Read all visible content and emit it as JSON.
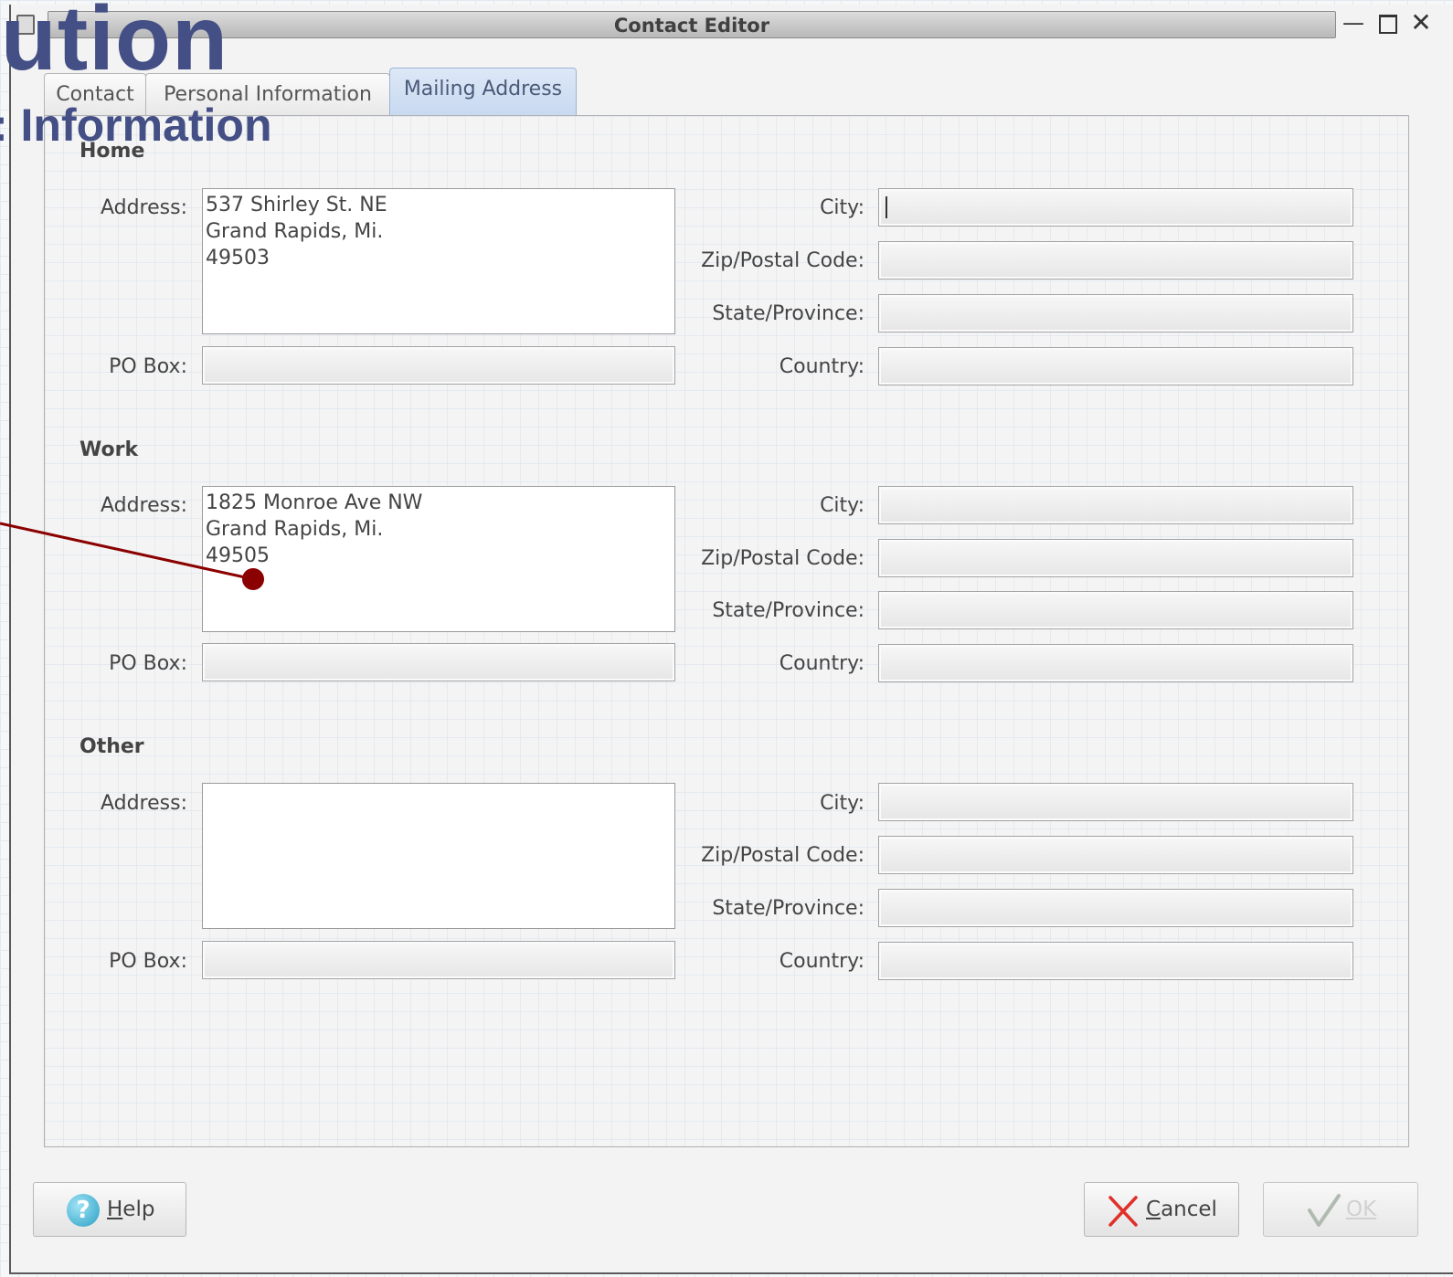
{
  "window": {
    "title": "Contact Editor"
  },
  "overlay": {
    "title": "lution",
    "subtitle": ": Information"
  },
  "tabs": [
    {
      "label": "Contact"
    },
    {
      "label": "Personal Information"
    },
    {
      "label": "Mailing Address"
    }
  ],
  "active_tab": "Mailing Address",
  "labels": {
    "address": "Address:",
    "po_box": "PO Box:",
    "city": "City:",
    "zip": "Zip/Postal Code:",
    "state": "State/Province:",
    "country": "Country:"
  },
  "sections": {
    "home": {
      "title": "Home",
      "address": "537 Shirley St. NE\nGrand Rapids, Mi.\n49503",
      "po_box": "",
      "city": "",
      "zip": "",
      "state": "",
      "country": ""
    },
    "work": {
      "title": "Work",
      "address": "1825 Monroe Ave NW\nGrand Rapids, Mi.\n49505",
      "po_box": "",
      "city": "",
      "zip": "",
      "state": "",
      "country": ""
    },
    "other": {
      "title": "Other",
      "address": "",
      "po_box": "",
      "city": "",
      "zip": "",
      "state": "",
      "country": ""
    }
  },
  "buttons": {
    "help": {
      "prefix": "",
      "mnemonic": "H",
      "rest": "elp"
    },
    "cancel": {
      "prefix": "",
      "mnemonic": "C",
      "rest": "ancel"
    },
    "ok": {
      "label": "OK",
      "enabled": false
    }
  },
  "colors": {
    "overlay_text": "#434f85",
    "annotation": "#8b0000"
  },
  "icons": [
    "window-menu-icon",
    "minimize-icon",
    "maximize-icon",
    "close-icon",
    "help-icon",
    "cancel-x-icon",
    "ok-check-icon"
  ]
}
